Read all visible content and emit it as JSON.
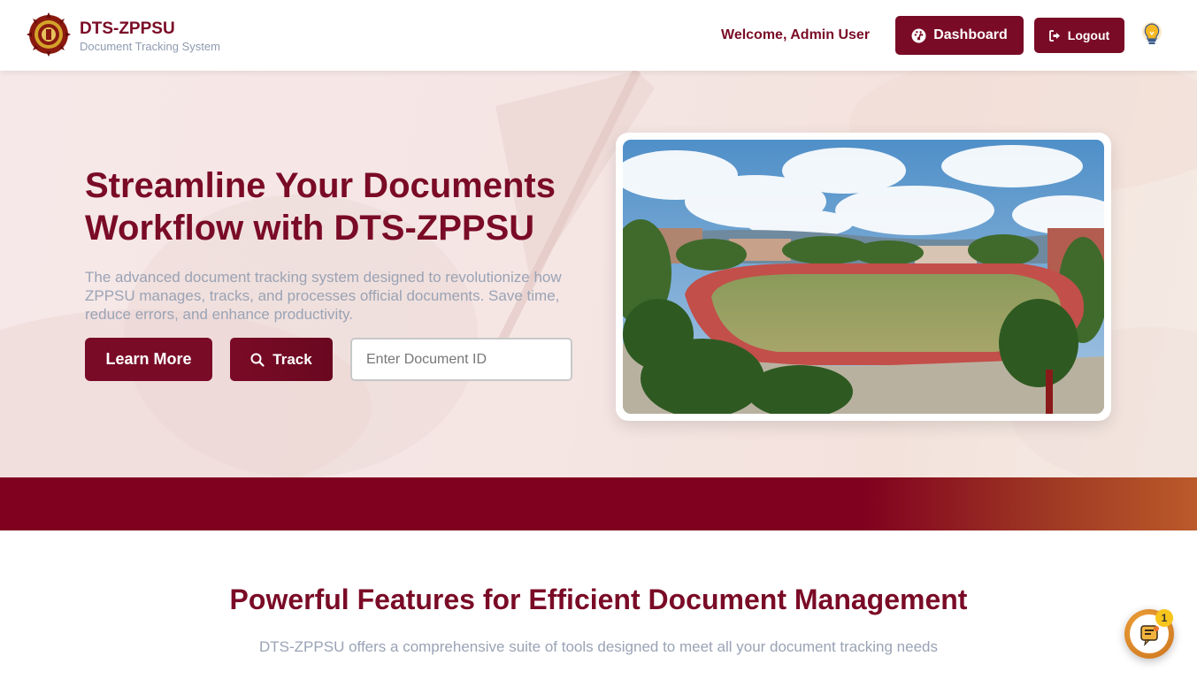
{
  "header": {
    "brand_title": "DTS-ZPPSU",
    "brand_subtitle": "Document Tracking System",
    "welcome_text": "Welcome, Admin User",
    "dashboard_label": "Dashboard",
    "logout_label": "Logout"
  },
  "hero": {
    "title": "Streamline Your Documents Workflow with DTS-ZPPSU",
    "description": "The advanced document tracking system designed to revolutionize how ZPPSU manages, tracks, and processes official documents. Save time, reduce errors, and enhance productivity.",
    "learn_more_label": "Learn More",
    "track_label": "Track",
    "document_id_placeholder": "Enter Document ID",
    "document_id_value": ""
  },
  "features": {
    "title": "Powerful Features for Efficient Document Management",
    "subtitle": "DTS-ZPPSU offers a comprehensive suite of tools designed to meet all your document tracking needs"
  },
  "chat_widget": {
    "badge_count": "1"
  },
  "colors": {
    "brand_maroon": "#7a0b26",
    "band_maroon": "#80001f",
    "band_orange": "#bb5a2a",
    "muted_text": "#9aa3b5",
    "badge_yellow": "#f7c51c"
  },
  "icons": {
    "logo": "university-seal-icon",
    "dashboard": "gauge-icon",
    "logout": "sign-out-icon",
    "theme": "lightbulb-icon",
    "track": "search-icon",
    "chat": "chatbot-icon"
  }
}
